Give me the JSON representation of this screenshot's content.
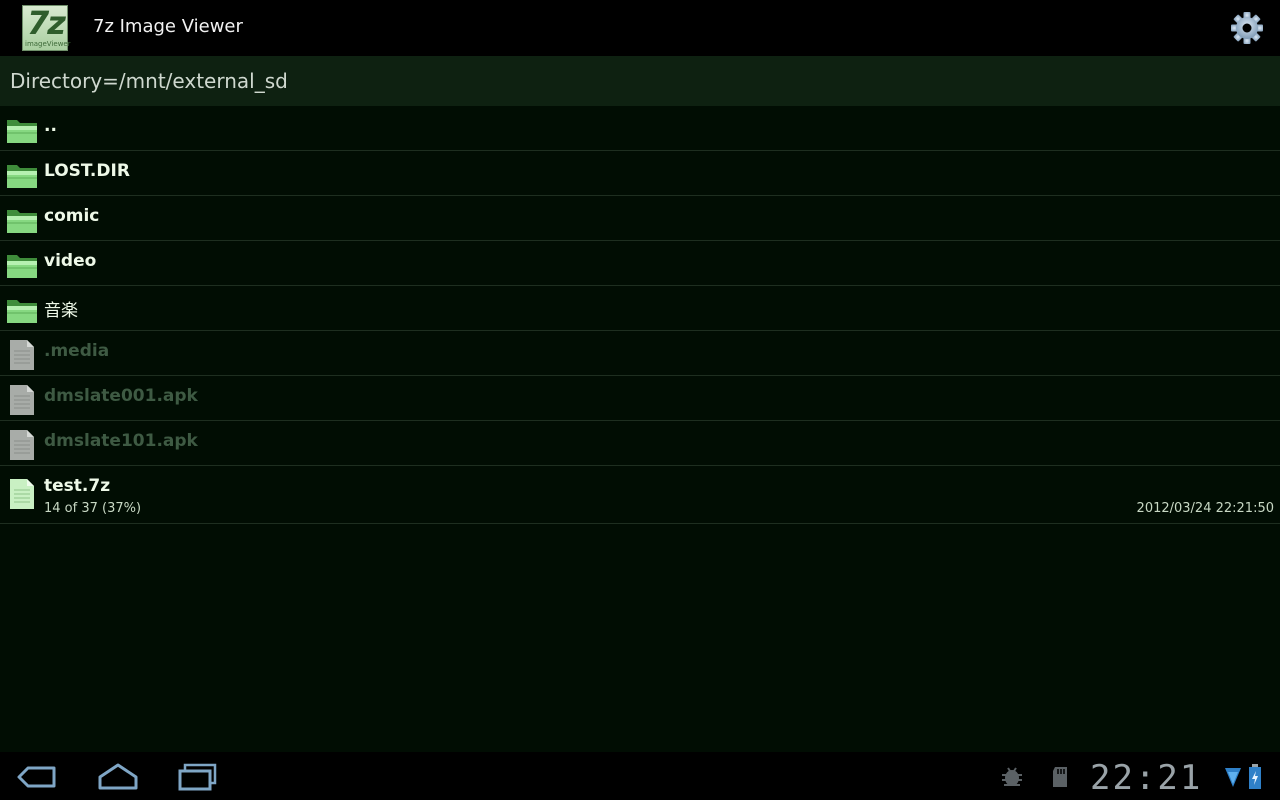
{
  "app": {
    "icon_label": "7z",
    "icon_caption": "imageViewer",
    "title": "7z Image Viewer"
  },
  "directory": {
    "label": "Directory=/mnt/external_sd"
  },
  "files": [
    {
      "name": "..",
      "type": "folder"
    },
    {
      "name": "LOST.DIR",
      "type": "folder"
    },
    {
      "name": "comic",
      "type": "folder"
    },
    {
      "name": "video",
      "type": "folder"
    },
    {
      "name": "音楽",
      "type": "folder"
    },
    {
      "name": ".media",
      "type": "file-disabled"
    },
    {
      "name": "dmslate001.apk",
      "type": "file-disabled"
    },
    {
      "name": "dmslate101.apk",
      "type": "file-disabled"
    },
    {
      "name": "test.7z",
      "type": "archive",
      "progress": "14 of 37 (37%)",
      "date": "2012/03/24 22:21:50"
    }
  ],
  "status_bar": {
    "clock": "22:21"
  },
  "colors": {
    "folder_green": "#7fd37a",
    "list_bg": "#010d03",
    "header_bg": "#0e2111"
  }
}
